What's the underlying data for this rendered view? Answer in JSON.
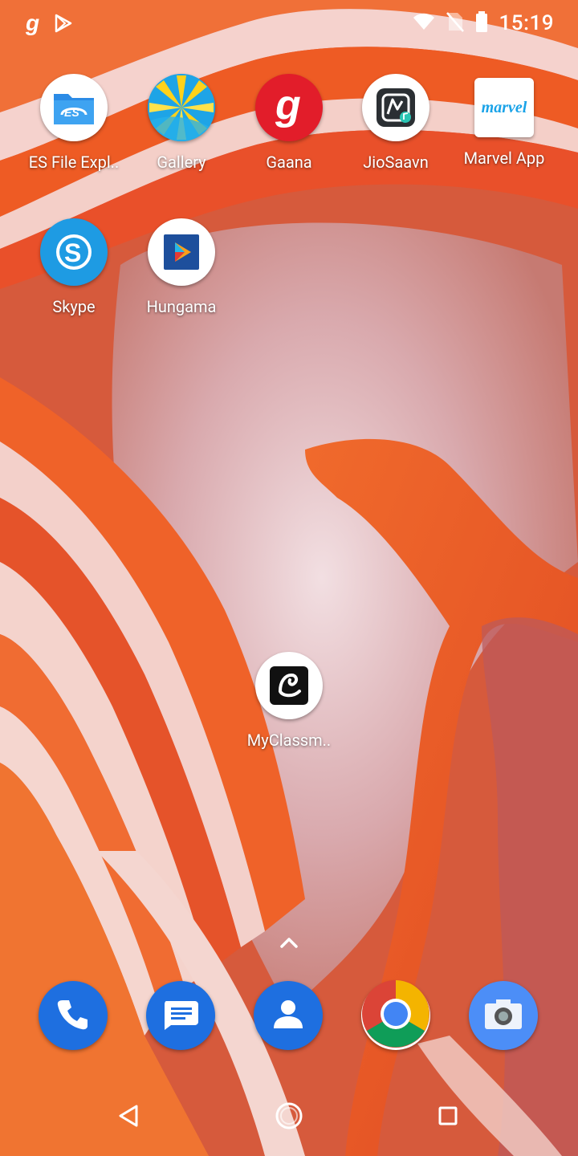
{
  "status_bar": {
    "time": "15:19",
    "left_icons": [
      "gaana-notification-icon",
      "play-store-notification-icon"
    ],
    "right_icons": [
      "wifi-icon",
      "no-sim-icon",
      "battery-icon"
    ]
  },
  "apps": [
    {
      "label": "ES File Expl..",
      "icon": "es-file-explorer-icon"
    },
    {
      "label": "Gallery",
      "icon": "gallery-icon"
    },
    {
      "label": "Gaana",
      "icon": "gaana-icon"
    },
    {
      "label": "JioSaavn",
      "icon": "jiosaavn-icon"
    },
    {
      "label": "Marvel App",
      "icon": "marvel-icon",
      "icon_text": "marvel"
    },
    {
      "label": "Skype",
      "icon": "skype-icon"
    },
    {
      "label": "Hungama",
      "icon": "hungama-icon"
    },
    {
      "label": "MyClassm..",
      "icon": "myclassmate-icon"
    }
  ],
  "dock": [
    {
      "name": "phone",
      "icon": "phone-icon"
    },
    {
      "name": "messages",
      "icon": "messages-icon"
    },
    {
      "name": "contacts",
      "icon": "contacts-icon"
    },
    {
      "name": "chrome",
      "icon": "chrome-icon"
    },
    {
      "name": "camera",
      "icon": "camera-icon"
    }
  ],
  "nav": [
    "back-icon",
    "home-icon",
    "recents-icon"
  ],
  "colors": {
    "wallpaper_base": "#d9573a",
    "agate_orange": "#f2652a",
    "agate_light": "#f3d4d0",
    "crystal_white": "#e8d8dc",
    "dock_blue": "#2a6fd8",
    "gaana_red": "#e21d2a",
    "skype_blue": "#1e9be3"
  }
}
